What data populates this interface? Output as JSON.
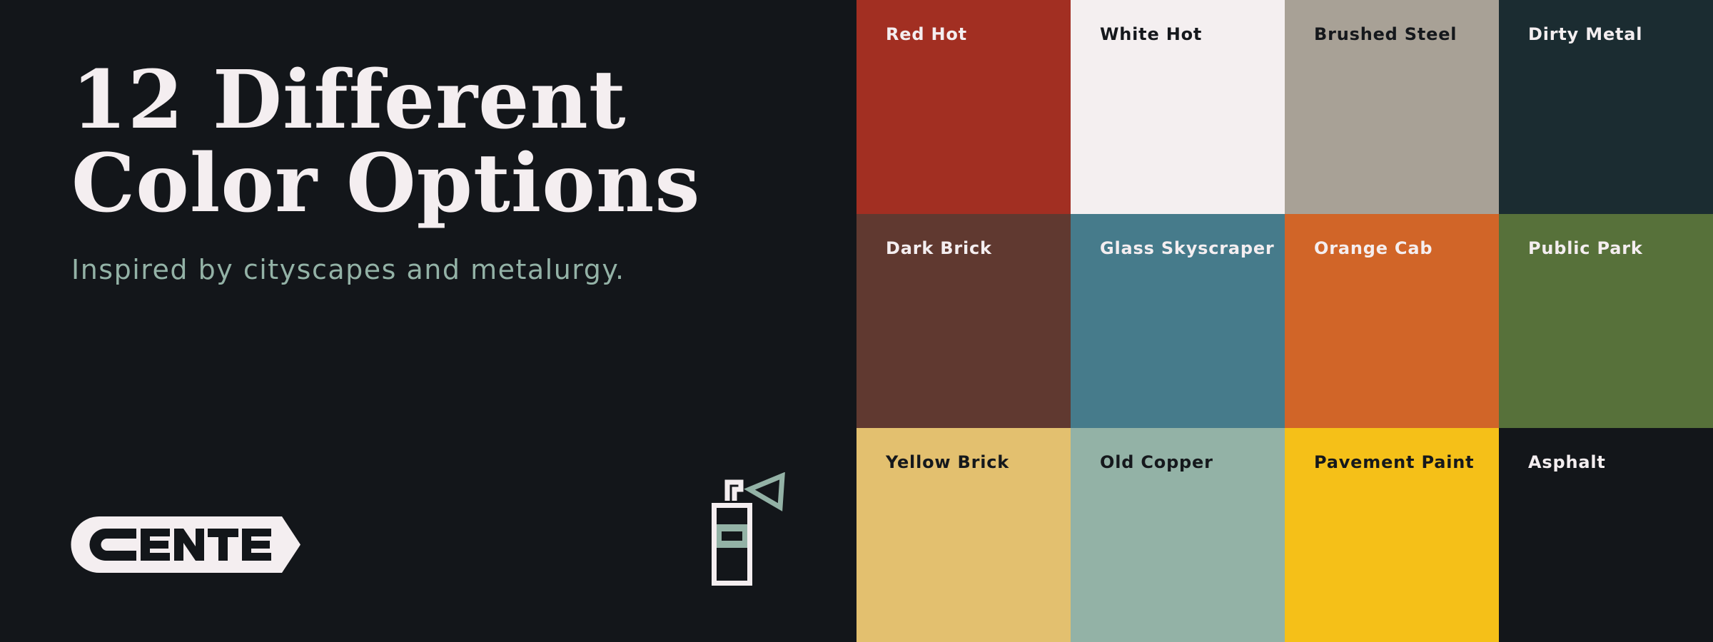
{
  "heading": {
    "line1": "12 Different",
    "line2": "Color Options"
  },
  "subtitle": "Inspired by cityscapes and metalurgy.",
  "logo": {
    "text": "CENTE",
    "icon": "cente-logo"
  },
  "decoration": {
    "icon": "spray-can-icon",
    "accent": "#93b2a6"
  },
  "colors": {
    "background": "#13161a",
    "heading": "#f4eef0",
    "subtitle": "#93b2a6"
  },
  "swatches": [
    {
      "name": "Red Hot",
      "hex": "#a22f22",
      "text": "light"
    },
    {
      "name": "White Hot",
      "hex": "#f4eff0",
      "text": "dark"
    },
    {
      "name": "Brushed Steel",
      "hex": "#a8a196",
      "text": "dark"
    },
    {
      "name": "Dirty Metal",
      "hex": "#1b2c31",
      "text": "light"
    },
    {
      "name": "Dark Brick",
      "hex": "#603930",
      "text": "light"
    },
    {
      "name": "Glass Skyscraper",
      "hex": "#467b8b",
      "text": "light"
    },
    {
      "name": "Orange Cab",
      "hex": "#d16528",
      "text": "light"
    },
    {
      "name": "Public Park",
      "hex": "#57713a",
      "text": "light"
    },
    {
      "name": "Yellow Brick",
      "hex": "#e3c06f",
      "text": "dark"
    },
    {
      "name": "Old Copper",
      "hex": "#93b2a6",
      "text": "dark"
    },
    {
      "name": "Pavement Paint",
      "hex": "#f5c018",
      "text": "dark"
    },
    {
      "name": "Asphalt",
      "hex": "#13161a",
      "text": "light"
    }
  ]
}
